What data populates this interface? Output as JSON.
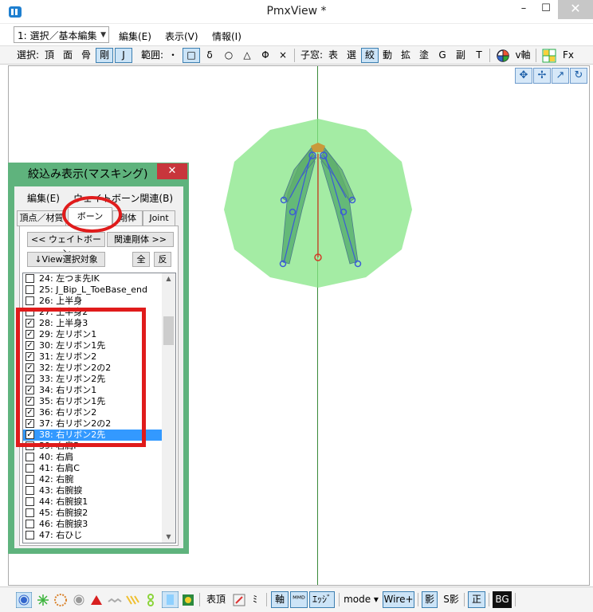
{
  "window": {
    "title": "PmxView *",
    "min": "–",
    "max": "☐",
    "close": "✕"
  },
  "menubar": {
    "mode_value": "1: 選択／基本編集",
    "items": [
      "編集(E)",
      "表示(V)",
      "情報(I)"
    ]
  },
  "toolbar": {
    "items": [
      "選択:",
      "頂",
      "面",
      "骨",
      "剛",
      "J",
      "範囲:",
      "・",
      "□",
      "δ",
      "○",
      "△",
      "Φ",
      "×",
      "子窓:",
      "表",
      "選",
      "絞",
      "動",
      "拡",
      "塗",
      "G",
      "副",
      "T",
      "v軸",
      "Fx"
    ],
    "active": [
      "剛",
      "J",
      "□",
      "絞"
    ]
  },
  "colors": {
    "accent": "#3399ff",
    "panel_green": "#5fb37d",
    "annotation_red": "#e01b1b",
    "model_green": "#86e686"
  },
  "panel": {
    "title": "絞込み表示(マスキング)",
    "close": "✕",
    "menu": [
      "編集(E)",
      "ウェイトボーン関連(B)"
    ],
    "tabs": [
      "頂点／材質",
      "ボーン",
      "剛体",
      "Joint"
    ],
    "active_tab": "ボーン",
    "btn_weight": "<< ウェイトボーン",
    "btn_related": "関連剛体 >>",
    "btn_view": "↓View選択対象",
    "btn_all": "全",
    "btn_invert": "反",
    "bones": [
      {
        "label": "24: 左つま先IK",
        "checked": false
      },
      {
        "label": "25: J_Bip_L_ToeBase_end",
        "checked": false
      },
      {
        "label": "26: 上半身",
        "checked": false
      },
      {
        "label": "27: 上半身2",
        "checked": false
      },
      {
        "label": "28: 上半身3",
        "checked": true
      },
      {
        "label": "29: 左リボン1",
        "checked": true
      },
      {
        "label": "30: 左リボン1先",
        "checked": true
      },
      {
        "label": "31: 左リボン2",
        "checked": true
      },
      {
        "label": "32: 左リボン2の2",
        "checked": true
      },
      {
        "label": "33: 左リボン2先",
        "checked": true
      },
      {
        "label": "34: 右リボン1",
        "checked": true
      },
      {
        "label": "35: 右リボン1先",
        "checked": true
      },
      {
        "label": "36: 右リボン2",
        "checked": true
      },
      {
        "label": "37: 右リボン2の2",
        "checked": true
      },
      {
        "label": "38: 右リボン2先",
        "checked": true,
        "selected": true
      },
      {
        "label": "39: 右肩P",
        "checked": false
      },
      {
        "label": "40: 右肩",
        "checked": false
      },
      {
        "label": "41: 右肩C",
        "checked": false
      },
      {
        "label": "42: 右腕",
        "checked": false
      },
      {
        "label": "43: 右腕捩",
        "checked": false
      },
      {
        "label": "44: 右腕捩1",
        "checked": false
      },
      {
        "label": "45: 右腕捩2",
        "checked": false
      },
      {
        "label": "46: 右腕捩3",
        "checked": false
      },
      {
        "label": "47: 右ひじ",
        "checked": false
      }
    ]
  },
  "viewport": {
    "nav_icons": [
      "move-xy-icon",
      "move-xz-icon",
      "zoom-icon",
      "rotate-icon"
    ]
  },
  "statusbar": {
    "labels": {
      "hyochou": "表頂",
      "mi": "ﾐ",
      "jiku": "軸",
      "mmd": "ᴹᴹᴰ",
      "edge": "ｴｯｼﾞ",
      "mode": "mode ▾",
      "wire": "Wire+",
      "kage": "影",
      "s_kage": "S影",
      "sei": "正",
      "bg": "BG"
    }
  }
}
